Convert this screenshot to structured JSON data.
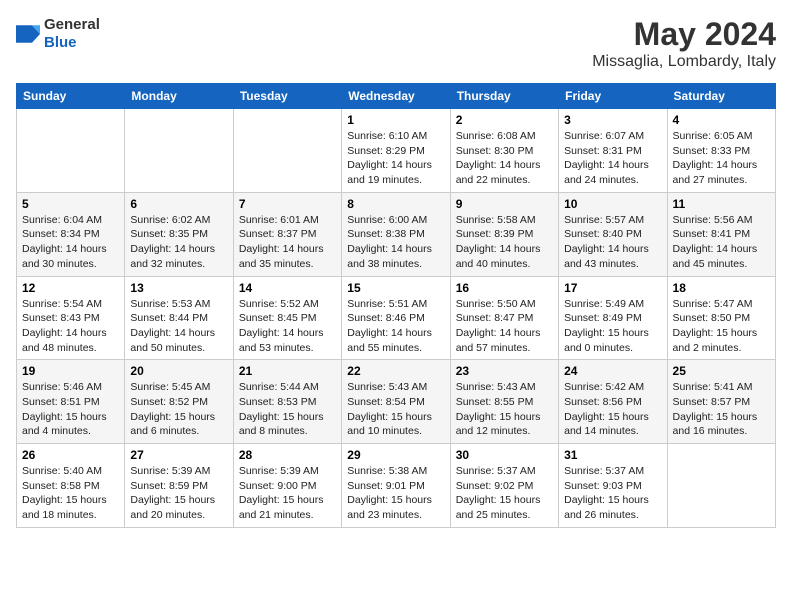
{
  "header": {
    "logo_general": "General",
    "logo_blue": "Blue",
    "month_title": "May 2024",
    "location": "Missaglia, Lombardy, Italy"
  },
  "days_of_week": [
    "Sunday",
    "Monday",
    "Tuesday",
    "Wednesday",
    "Thursday",
    "Friday",
    "Saturday"
  ],
  "weeks": [
    [
      {
        "day": "",
        "text": ""
      },
      {
        "day": "",
        "text": ""
      },
      {
        "day": "",
        "text": ""
      },
      {
        "day": "1",
        "text": "Sunrise: 6:10 AM\nSunset: 8:29 PM\nDaylight: 14 hours\nand 19 minutes."
      },
      {
        "day": "2",
        "text": "Sunrise: 6:08 AM\nSunset: 8:30 PM\nDaylight: 14 hours\nand 22 minutes."
      },
      {
        "day": "3",
        "text": "Sunrise: 6:07 AM\nSunset: 8:31 PM\nDaylight: 14 hours\nand 24 minutes."
      },
      {
        "day": "4",
        "text": "Sunrise: 6:05 AM\nSunset: 8:33 PM\nDaylight: 14 hours\nand 27 minutes."
      }
    ],
    [
      {
        "day": "5",
        "text": "Sunrise: 6:04 AM\nSunset: 8:34 PM\nDaylight: 14 hours\nand 30 minutes."
      },
      {
        "day": "6",
        "text": "Sunrise: 6:02 AM\nSunset: 8:35 PM\nDaylight: 14 hours\nand 32 minutes."
      },
      {
        "day": "7",
        "text": "Sunrise: 6:01 AM\nSunset: 8:37 PM\nDaylight: 14 hours\nand 35 minutes."
      },
      {
        "day": "8",
        "text": "Sunrise: 6:00 AM\nSunset: 8:38 PM\nDaylight: 14 hours\nand 38 minutes."
      },
      {
        "day": "9",
        "text": "Sunrise: 5:58 AM\nSunset: 8:39 PM\nDaylight: 14 hours\nand 40 minutes."
      },
      {
        "day": "10",
        "text": "Sunrise: 5:57 AM\nSunset: 8:40 PM\nDaylight: 14 hours\nand 43 minutes."
      },
      {
        "day": "11",
        "text": "Sunrise: 5:56 AM\nSunset: 8:41 PM\nDaylight: 14 hours\nand 45 minutes."
      }
    ],
    [
      {
        "day": "12",
        "text": "Sunrise: 5:54 AM\nSunset: 8:43 PM\nDaylight: 14 hours\nand 48 minutes."
      },
      {
        "day": "13",
        "text": "Sunrise: 5:53 AM\nSunset: 8:44 PM\nDaylight: 14 hours\nand 50 minutes."
      },
      {
        "day": "14",
        "text": "Sunrise: 5:52 AM\nSunset: 8:45 PM\nDaylight: 14 hours\nand 53 minutes."
      },
      {
        "day": "15",
        "text": "Sunrise: 5:51 AM\nSunset: 8:46 PM\nDaylight: 14 hours\nand 55 minutes."
      },
      {
        "day": "16",
        "text": "Sunrise: 5:50 AM\nSunset: 8:47 PM\nDaylight: 14 hours\nand 57 minutes."
      },
      {
        "day": "17",
        "text": "Sunrise: 5:49 AM\nSunset: 8:49 PM\nDaylight: 15 hours\nand 0 minutes."
      },
      {
        "day": "18",
        "text": "Sunrise: 5:47 AM\nSunset: 8:50 PM\nDaylight: 15 hours\nand 2 minutes."
      }
    ],
    [
      {
        "day": "19",
        "text": "Sunrise: 5:46 AM\nSunset: 8:51 PM\nDaylight: 15 hours\nand 4 minutes."
      },
      {
        "day": "20",
        "text": "Sunrise: 5:45 AM\nSunset: 8:52 PM\nDaylight: 15 hours\nand 6 minutes."
      },
      {
        "day": "21",
        "text": "Sunrise: 5:44 AM\nSunset: 8:53 PM\nDaylight: 15 hours\nand 8 minutes."
      },
      {
        "day": "22",
        "text": "Sunrise: 5:43 AM\nSunset: 8:54 PM\nDaylight: 15 hours\nand 10 minutes."
      },
      {
        "day": "23",
        "text": "Sunrise: 5:43 AM\nSunset: 8:55 PM\nDaylight: 15 hours\nand 12 minutes."
      },
      {
        "day": "24",
        "text": "Sunrise: 5:42 AM\nSunset: 8:56 PM\nDaylight: 15 hours\nand 14 minutes."
      },
      {
        "day": "25",
        "text": "Sunrise: 5:41 AM\nSunset: 8:57 PM\nDaylight: 15 hours\nand 16 minutes."
      }
    ],
    [
      {
        "day": "26",
        "text": "Sunrise: 5:40 AM\nSunset: 8:58 PM\nDaylight: 15 hours\nand 18 minutes."
      },
      {
        "day": "27",
        "text": "Sunrise: 5:39 AM\nSunset: 8:59 PM\nDaylight: 15 hours\nand 20 minutes."
      },
      {
        "day": "28",
        "text": "Sunrise: 5:39 AM\nSunset: 9:00 PM\nDaylight: 15 hours\nand 21 minutes."
      },
      {
        "day": "29",
        "text": "Sunrise: 5:38 AM\nSunset: 9:01 PM\nDaylight: 15 hours\nand 23 minutes."
      },
      {
        "day": "30",
        "text": "Sunrise: 5:37 AM\nSunset: 9:02 PM\nDaylight: 15 hours\nand 25 minutes."
      },
      {
        "day": "31",
        "text": "Sunrise: 5:37 AM\nSunset: 9:03 PM\nDaylight: 15 hours\nand 26 minutes."
      },
      {
        "day": "",
        "text": ""
      }
    ]
  ]
}
